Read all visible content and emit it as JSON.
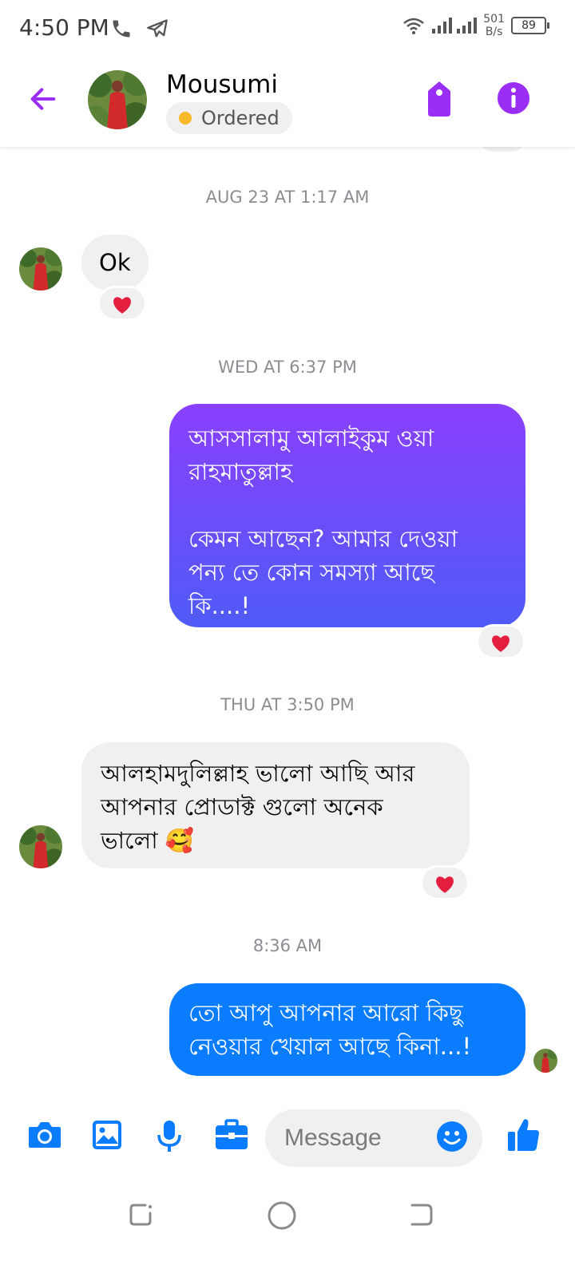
{
  "status_bar": {
    "time": "4:50 PM",
    "net_speed_value": "501",
    "net_speed_unit": "B/s",
    "battery": "89"
  },
  "header": {
    "contact_name": "Mousumi",
    "status_label": "Ordered",
    "status_color": "#f7b928",
    "accent": "#9b2ef5"
  },
  "messages": {
    "ts1": "AUG 23 AT 1:17 AM",
    "m1": "Ok",
    "ts2": "WED AT 6:37 PM",
    "m2": "আসসালামু আলাইকুম ওয়া\nরাহমাতুল্লাহ\n\nকেমন আছেন? আমার দেওয়া\nপন্য তে কোন সমস্যা আছে\nকি....!",
    "ts3": "THU AT 3:50 PM",
    "m3_text": "আলহামদুলিল্লাহ ভালো আছি আর\nআপনার প্রোডাক্ট গুলো অনেক\nভালো",
    "m3_emoji": "🥰",
    "ts4": "8:36 AM",
    "m4": "তো আপু আপনার আরো কিছু\nনেওয়ার খেয়াল আছে কিনা...!",
    "reaction": "heart-icon",
    "out_gradient": [
      "#8a3ffc",
      "#4f5bf6"
    ],
    "out_blue": "#0a7cff"
  },
  "composer": {
    "placeholder": "Message",
    "icon_color": "#0a7cff"
  }
}
